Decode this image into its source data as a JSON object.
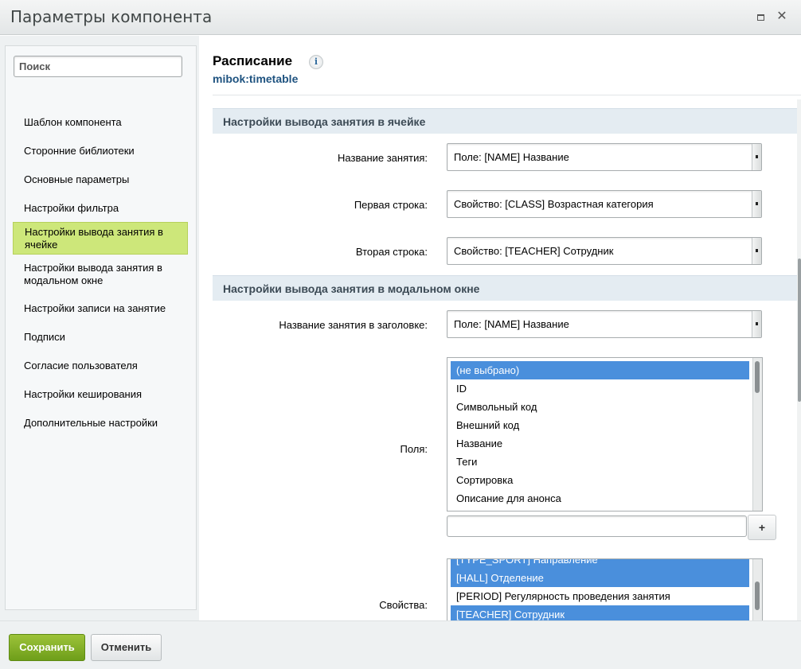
{
  "window": {
    "title": "Параметры компонента",
    "maximize_icon": "maximize-icon",
    "close_icon": "close-icon",
    "close_glyph": "✕"
  },
  "sidebar": {
    "search_placeholder": "Поиск",
    "items": [
      {
        "label": "Шаблон компонента"
      },
      {
        "label": "Сторонние библиотеки"
      },
      {
        "label": "Основные параметры"
      },
      {
        "label": "Настройки фильтра"
      },
      {
        "label": "Настройки вывода занятия в ячейке",
        "active": true
      },
      {
        "label": "Настройки вывода занятия в модальном окне"
      },
      {
        "label": "Настройки записи на занятие"
      },
      {
        "label": "Подписи"
      },
      {
        "label": "Согласие пользователя"
      },
      {
        "label": "Настройки кеширования"
      },
      {
        "label": "Дополнительные настройки"
      }
    ]
  },
  "component": {
    "title": "Расписание",
    "code": "mibok:timetable",
    "info_glyph": "i"
  },
  "sections": {
    "cell": {
      "header": "Настройки вывода занятия в ячейке",
      "fields": [
        {
          "label": "Название занятия:",
          "value": "Поле: [NAME] Название"
        },
        {
          "label": "Первая строка:",
          "value": "Свойство: [CLASS] Возрастная категория"
        },
        {
          "label": "Вторая строка:",
          "value": "Свойство: [TEACHER] Сотрудник"
        }
      ]
    },
    "modal": {
      "header": "Настройки вывода занятия в модальном окне",
      "title_field": {
        "label": "Название занятия в заголовке:",
        "value": "Поле: [NAME] Название"
      },
      "fields_list": {
        "label": "Поля:",
        "options": [
          {
            "text": "(не выбрано)",
            "selected": true
          },
          {
            "text": "ID",
            "selected": false
          },
          {
            "text": "Символьный код",
            "selected": false
          },
          {
            "text": "Внешний код",
            "selected": false
          },
          {
            "text": "Название",
            "selected": false
          },
          {
            "text": "Теги",
            "selected": false
          },
          {
            "text": "Сортировка",
            "selected": false
          },
          {
            "text": "Описание для анонса",
            "selected": false
          }
        ],
        "add_button": "+"
      },
      "properties_list": {
        "label": "Свойства:",
        "options": [
          {
            "text": "[TYPE_SPORT] Направление",
            "selected": true
          },
          {
            "text": "[HALL] Отделение",
            "selected": true
          },
          {
            "text": "[PERIOD] Регулярность проведения занятия",
            "selected": false
          },
          {
            "text": "[TEACHER] Сотрудник",
            "selected": true
          }
        ]
      }
    }
  },
  "footer": {
    "save_label": "Сохранить",
    "cancel_label": "Отменить"
  },
  "colors": {
    "active_nav": "#cde77a",
    "section_bg": "#e4ecf2",
    "selected_option": "#4a8fdc",
    "save_button": "#7aa823",
    "component_code": "#1f5380"
  }
}
